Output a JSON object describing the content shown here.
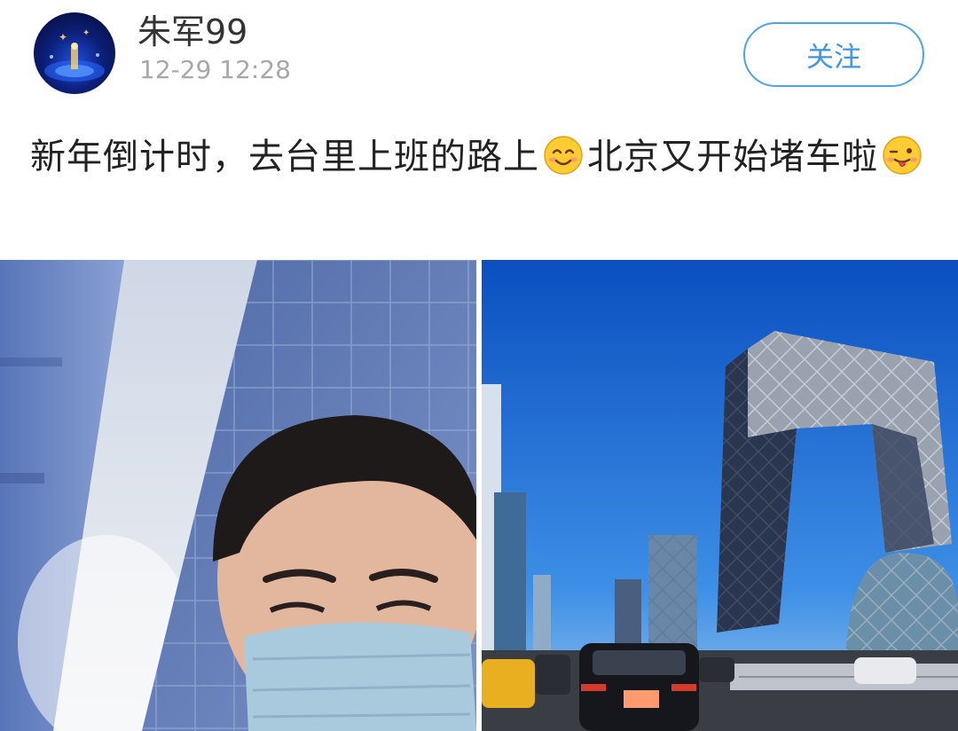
{
  "post": {
    "author": {
      "name": "朱军99",
      "timestamp": "12-29 12:28",
      "avatar_icon": "avatar-image"
    },
    "follow_label": "关注",
    "text": {
      "part1": "新年倒计时，去台里上班的路上",
      "emoji1": "smile-emoji",
      "part2": "北京又开始堵车啦",
      "emoji2": "tongue-wink-emoji"
    },
    "images": [
      {
        "name": "selfie-photo",
        "description_icon": "photo"
      },
      {
        "name": "cctv-building-traffic-photo",
        "description_icon": "photo"
      }
    ],
    "colors": {
      "follow_border": "#4fa3e4",
      "follow_text": "#3f95e0",
      "timestamp": "#a8a8a8",
      "text": "#222222"
    }
  }
}
